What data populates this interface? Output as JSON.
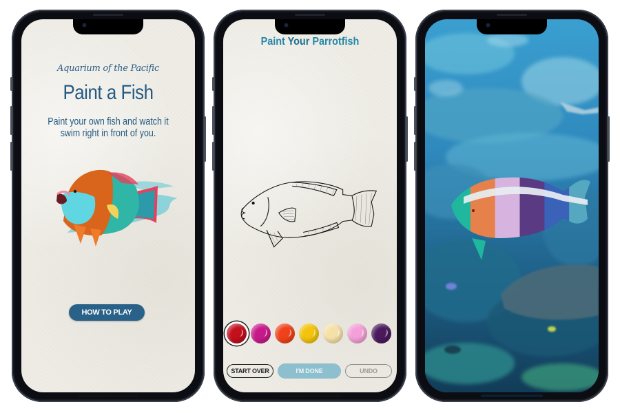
{
  "screens": [
    {
      "id": "intro",
      "brand_logo_text": "Aquarium of the Pacific",
      "title": "Paint a Fish",
      "subtitle": "Paint your own fish and watch it swim right in front of you.",
      "hero_image": "painted-parrotfish-illustration",
      "primary_button": "HOW TO PLAY"
    },
    {
      "id": "paint",
      "title_parts": [
        "Paint ",
        "Your",
        " Parrotfish"
      ],
      "canvas_image": "parrotfish-outline-drawing",
      "palette": {
        "selected_index": 0,
        "colors": [
          {
            "name": "red",
            "hex": "#c3101c"
          },
          {
            "name": "magenta",
            "hex": "#c71a8a"
          },
          {
            "name": "orange",
            "hex": "#f0421a"
          },
          {
            "name": "yellow",
            "hex": "#f2c40c"
          },
          {
            "name": "cream",
            "hex": "#f5e1a8"
          },
          {
            "name": "pink",
            "hex": "#f3a0d8"
          },
          {
            "name": "purple",
            "hex": "#4a1a5c"
          }
        ]
      },
      "buttons": {
        "start_over": "START OVER",
        "done": "I'M DONE",
        "undo": "UNDO"
      }
    },
    {
      "id": "ar-view",
      "background_image": "aquarium-reef-camera-view",
      "painted_fish": {
        "stripe_colors": [
          "#1fb79e",
          "#e7814b",
          "#d7b4e0",
          "#5a3a82",
          "#3a62b8",
          "#56a7c0"
        ],
        "band_color": "#e8eef2"
      }
    }
  ],
  "colors": {
    "brand_blue": "#245a82",
    "title_teal": "#2487a8",
    "paper": "#efede6",
    "button_primary": "#2a6189",
    "button_done": "#8dbfcf"
  }
}
